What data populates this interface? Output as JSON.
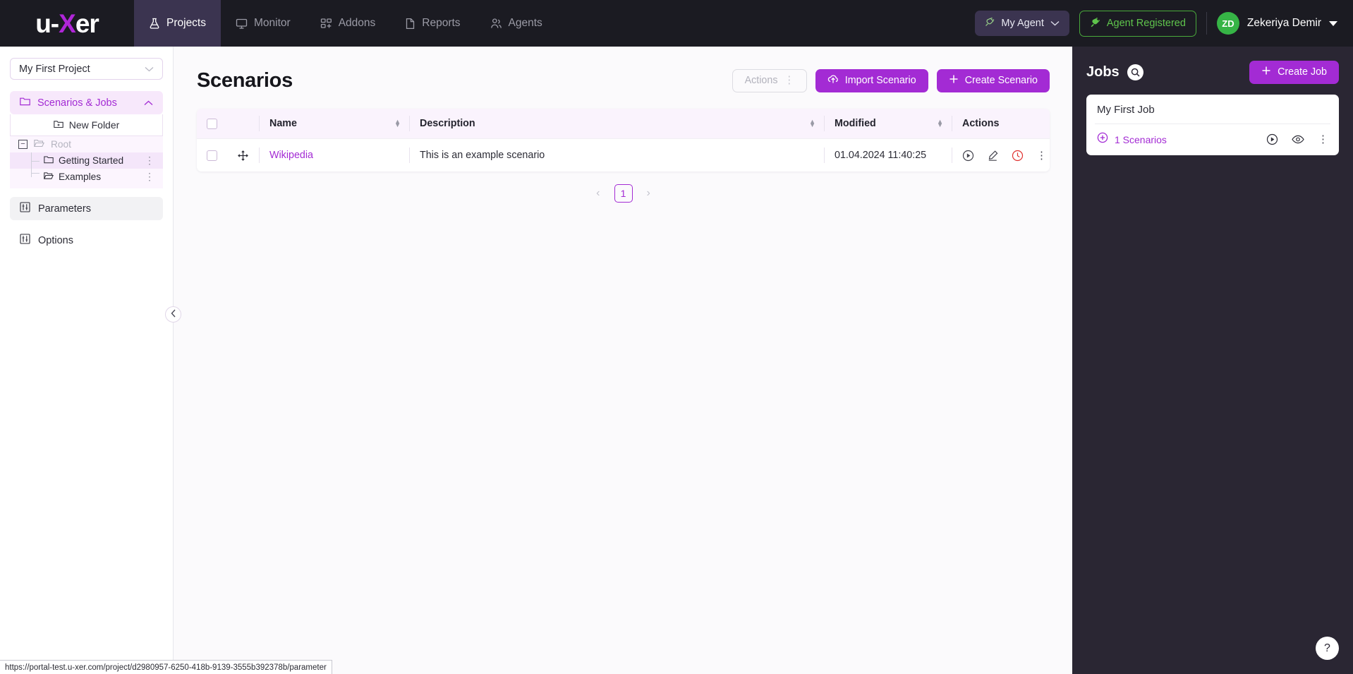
{
  "topnav": {
    "logo": {
      "pre": "u-",
      "x": "X",
      "post": "er"
    },
    "items": [
      {
        "label": "Projects",
        "icon": "flask-icon",
        "active": true
      },
      {
        "label": "Monitor",
        "icon": "monitor-icon",
        "active": false
      },
      {
        "label": "Addons",
        "icon": "grid-icon",
        "active": false
      },
      {
        "label": "Reports",
        "icon": "document-icon",
        "active": false
      },
      {
        "label": "Agents",
        "icon": "people-icon",
        "active": false
      }
    ],
    "agent_select": {
      "label": "My Agent",
      "icon": "plug-icon"
    },
    "agent_status": {
      "label": "Agent Registered",
      "icon": "plug-connected-icon",
      "color": "#5fc44c"
    },
    "user": {
      "initials": "ZD",
      "name": "Zekeriya Demir",
      "avatar_color": "#36b446"
    }
  },
  "sidebar": {
    "project_select": {
      "value": "My First Project"
    },
    "group": {
      "label": "Scenarios & Jobs",
      "icon": "folder-icon"
    },
    "new_folder": {
      "label": "New Folder",
      "icon": "folder-add-icon"
    },
    "tree": [
      {
        "label": "Root",
        "level": 0,
        "icon": "folder-open-icon",
        "selected": false,
        "muted": true
      },
      {
        "label": "Getting Started",
        "level": 1,
        "icon": "folder-icon",
        "selected": true,
        "muted": false
      },
      {
        "label": "Examples",
        "level": 1,
        "icon": "folder-open-icon",
        "selected": false,
        "muted": false
      }
    ],
    "buttons": [
      {
        "label": "Parameters",
        "icon": "sliders-icon",
        "shaded": true
      },
      {
        "label": "Options",
        "icon": "sliders-icon",
        "shaded": false
      }
    ],
    "collapse": {
      "icon": "chevron-left-icon"
    }
  },
  "main": {
    "title": "Scenarios",
    "actions_button": {
      "label": "Actions",
      "disabled": true
    },
    "import_button": {
      "label": "Import Scenario",
      "icon": "cloud-upload-icon"
    },
    "create_button": {
      "label": "Create Scenario",
      "icon": "plus-icon"
    },
    "table": {
      "columns": [
        "Name",
        "Description",
        "Modified",
        "Actions"
      ],
      "rows": [
        {
          "name": "Wikipedia",
          "description": "This is an example scenario",
          "modified": "01.04.2024 11:40:25",
          "actions": [
            "run-icon",
            "edit-icon",
            "schedule-icon",
            "more-icon"
          ]
        }
      ]
    },
    "pagination": {
      "prev": "‹",
      "page": "1",
      "next": "›"
    }
  },
  "jobs": {
    "title": "Jobs",
    "search_icon": "search-icon",
    "create_button": {
      "label": "Create Job",
      "icon": "plus-icon"
    },
    "cards": [
      {
        "name": "My First Job",
        "scenario_count": "1 Scenarios",
        "icons": [
          "run-icon",
          "view-icon",
          "more-icon"
        ]
      }
    ],
    "help": {
      "label": "?"
    }
  },
  "statusbar": {
    "url": "https://portal-test.u-xer.com/project/d2980957-6250-418b-9139-3555b392378b/parameter"
  },
  "colors": {
    "accent": "#a32bd4",
    "nav_bg": "#1b1b22",
    "nav_active": "#3b3450",
    "jobs_bg": "#2a2633",
    "green": "#5fc44c",
    "danger": "#e0312f"
  }
}
